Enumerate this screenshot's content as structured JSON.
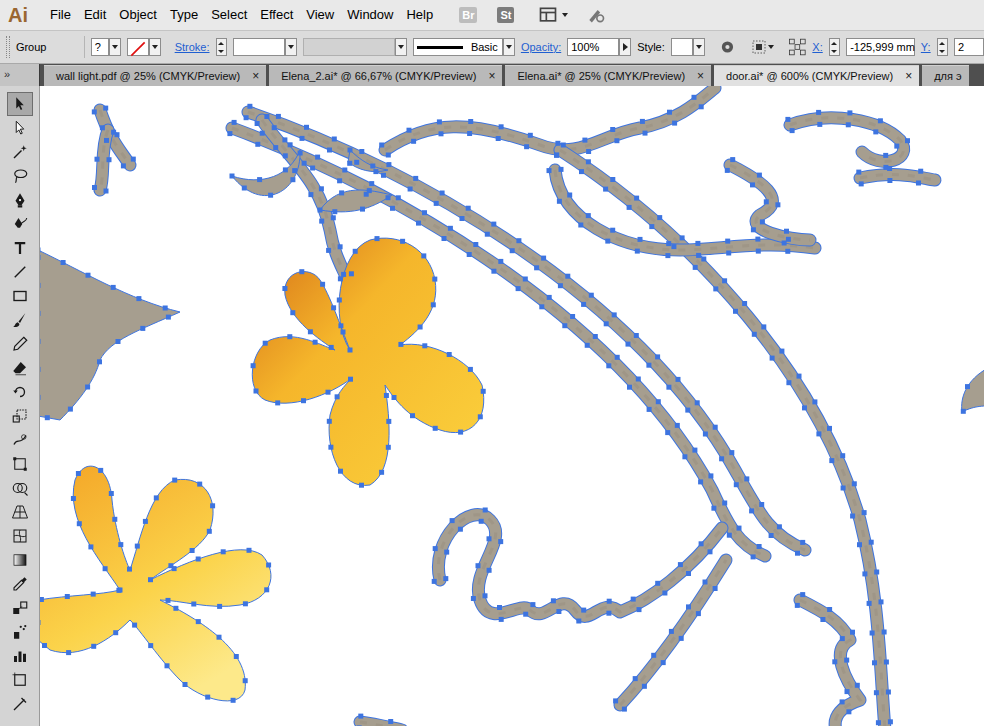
{
  "app": {
    "logo": "Ai"
  },
  "menu": [
    "File",
    "Edit",
    "Object",
    "Type",
    "Select",
    "Effect",
    "View",
    "Window",
    "Help"
  ],
  "menu_buttons": [
    "Br",
    "St"
  ],
  "control_bar": {
    "selection": "Group",
    "fill_menu": "?",
    "stroke_label": "Stroke:",
    "stroke_profile": "Basic",
    "opacity_label": "Opacity:",
    "opacity": "100%",
    "style_label": "Style:",
    "x_label": "X:",
    "x": "-125,999 mm",
    "y_label": "Y:",
    "y": "2"
  },
  "tabs": [
    {
      "label": "wall light.pdf @ 25% (CMYK/Preview)",
      "close": "×",
      "selected": false
    },
    {
      "label": "Elena_2.ai* @ 66,67% (CMYK/Preview)",
      "close": "×",
      "selected": false
    },
    {
      "label": "Elena.ai* @ 25% (CMYK/Preview)",
      "close": "×",
      "selected": false
    },
    {
      "label": "door.ai* @ 600% (CMYK/Preview)",
      "close": "×",
      "selected": true
    },
    {
      "label": "для э",
      "selected": false
    }
  ],
  "toolbar": {
    "collapse": "»",
    "tools": [
      {
        "selected": true
      },
      {
        "selected": false
      },
      {
        "selected": false
      },
      {
        "selected": false
      },
      {
        "selected": false
      },
      {
        "selected": false
      },
      {
        "selected": false
      },
      {
        "selected": false
      },
      {
        "selected": false
      },
      {
        "selected": false
      },
      {
        "selected": false
      },
      {
        "selected": false
      },
      {
        "selected": false
      },
      {
        "selected": false
      },
      {
        "selected": false
      },
      {
        "selected": false
      },
      {
        "selected": false
      },
      {
        "selected": false
      },
      {
        "selected": false
      },
      {
        "selected": false
      },
      {
        "selected": false
      },
      {
        "selected": false
      },
      {
        "selected": false
      },
      {
        "selected": false
      },
      {
        "selected": false
      },
      {
        "selected": false
      }
    ]
  }
}
